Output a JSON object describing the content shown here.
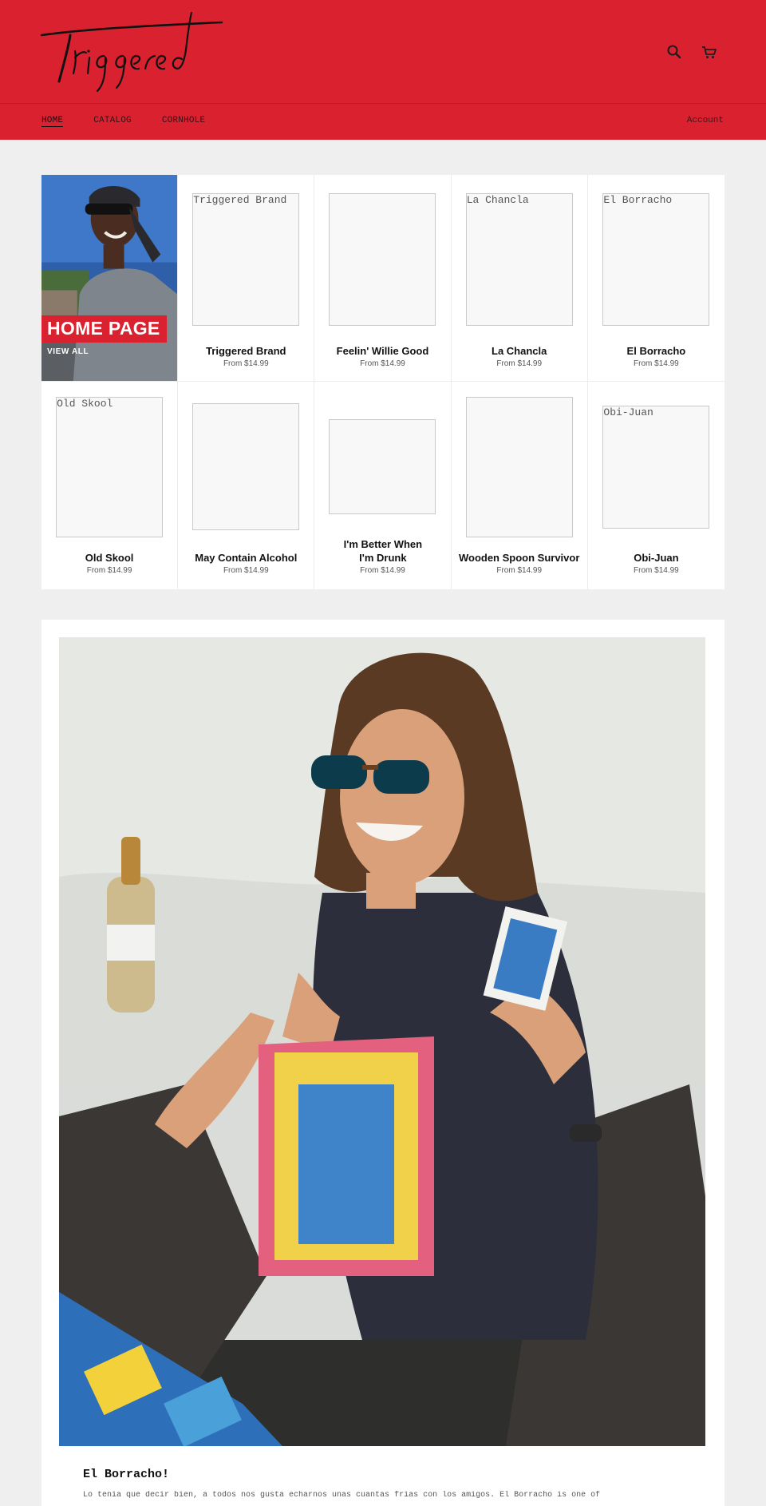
{
  "brand": {
    "name": "Triggered",
    "accent_color": "#da2130"
  },
  "header": {
    "icons": [
      "search-icon",
      "cart-icon"
    ]
  },
  "nav": {
    "items": [
      {
        "label": "HOME",
        "active": true
      },
      {
        "label": "CATALOG",
        "active": false
      },
      {
        "label": "CORNHOLE",
        "active": false
      }
    ],
    "account_label": "Account"
  },
  "feature": {
    "title": "HOME PAGE",
    "link_label": "VIEW ALL"
  },
  "products": [
    {
      "title": "Triggered Brand",
      "price": "From $14.99",
      "image_alt": "Triggered Brand"
    },
    {
      "title": "Feelin' Willie Good",
      "price": "From $14.99",
      "image_alt": ""
    },
    {
      "title": "La Chancla",
      "price": "From $14.99",
      "image_alt": "La Chancla"
    },
    {
      "title": "El Borracho",
      "price": "From $14.99",
      "image_alt": "El Borracho"
    },
    {
      "title": "Old Skool",
      "price": "From $14.99",
      "image_alt": "Old Skool"
    },
    {
      "title": "May Contain Alcohol",
      "price": "From $14.99",
      "image_alt": ""
    },
    {
      "title": "I'm Better When I'm Drunk",
      "price": "From $14.99",
      "image_alt": ""
    },
    {
      "title": "Wooden Spoon Survivor",
      "price": "From $14.99",
      "image_alt": ""
    },
    {
      "title": "Obi-Juan",
      "price": "From $14.99",
      "image_alt": "Obi-Juan"
    }
  ],
  "blog": {
    "title": "El Borracho!",
    "excerpt": "Lo tenia que decir bien, a todos nos gusta echarnos unas cuantas frias con los amigos. El Borracho is one of"
  }
}
